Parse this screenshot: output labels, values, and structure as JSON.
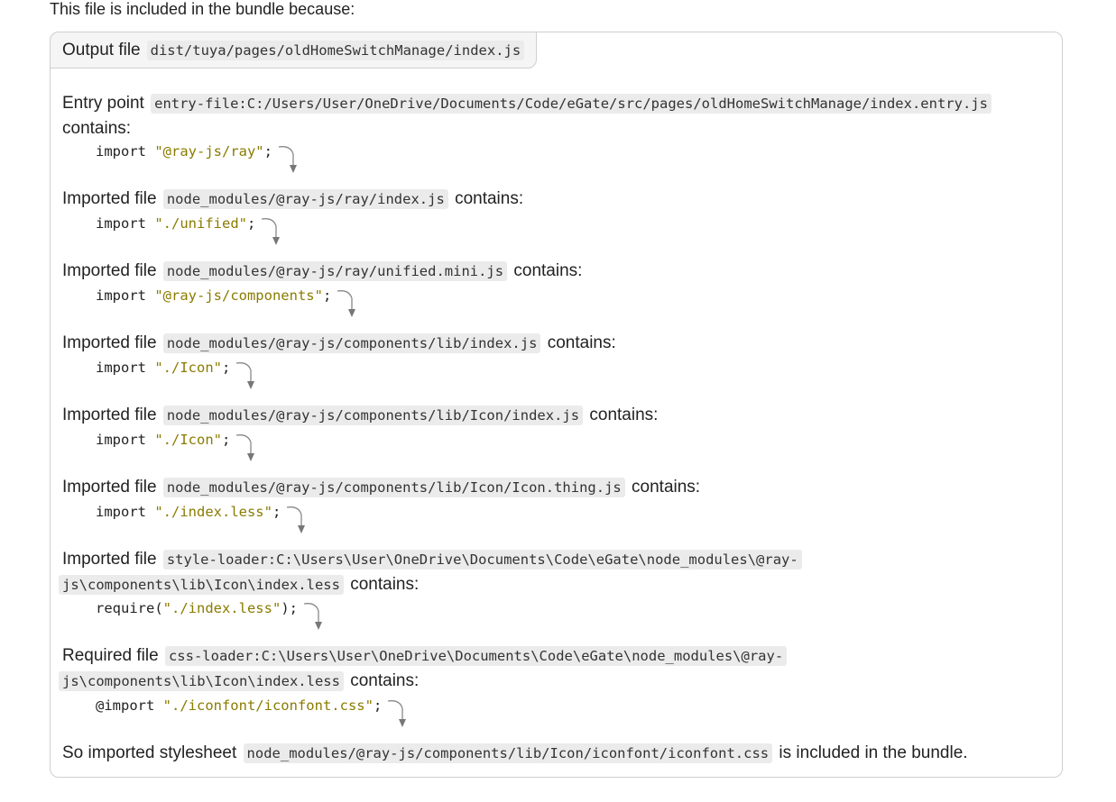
{
  "intro": "This file is included in the bundle because:",
  "output": {
    "label": "Output file",
    "path": "dist/tuya/pages/oldHomeSwitchManage/index.js"
  },
  "steps": [
    {
      "prefix": "Entry point",
      "path": "entry-file:C:/Users/User/OneDrive/Documents/Code/eGate/src/pages/oldHomeSwitchManage/index.entry.js",
      "suffix": "contains:",
      "keyword": "import ",
      "string": "\"@ray-js/ray\"",
      "tail": ";"
    },
    {
      "prefix": "Imported file",
      "path": "node_modules/@ray-js/ray/index.js",
      "suffix": "contains:",
      "keyword": "import ",
      "string": "\"./unified\"",
      "tail": ";"
    },
    {
      "prefix": "Imported file",
      "path": "node_modules/@ray-js/ray/unified.mini.js",
      "suffix": "contains:",
      "keyword": "import ",
      "string": "\"@ray-js/components\"",
      "tail": ";"
    },
    {
      "prefix": "Imported file",
      "path": "node_modules/@ray-js/components/lib/index.js",
      "suffix": "contains:",
      "keyword": "import ",
      "string": "\"./Icon\"",
      "tail": ";"
    },
    {
      "prefix": "Imported file",
      "path": "node_modules/@ray-js/components/lib/Icon/index.js",
      "suffix": "contains:",
      "keyword": "import ",
      "string": "\"./Icon\"",
      "tail": ";"
    },
    {
      "prefix": "Imported file",
      "path": "node_modules/@ray-js/components/lib/Icon/Icon.thing.js",
      "suffix": "contains:",
      "keyword": "import ",
      "string": "\"./index.less\"",
      "tail": ";"
    },
    {
      "prefix": "Imported file",
      "path_line1": "style-loader:C:\\Users\\User\\OneDrive\\Documents\\Code\\eGate\\node_modules\\@ray-",
      "path_line2": "js\\components\\lib\\Icon\\index.less",
      "suffix": "contains:",
      "keyword": "require(",
      "string": "\"./index.less\"",
      "tail": ");"
    },
    {
      "prefix": "Required file",
      "path_line1": "css-loader:C:\\Users\\User\\OneDrive\\Documents\\Code\\eGate\\node_modules\\@ray-",
      "path_line2": "js\\components\\lib\\Icon\\index.less",
      "suffix": "contains:",
      "keyword": "@import ",
      "string": "\"./iconfont/iconfont.css\"",
      "tail": ";"
    }
  ],
  "final": {
    "prefix": "So imported stylesheet",
    "path": "node_modules/@ray-js/components/lib/Icon/iconfont/iconfont.css",
    "suffix": "is included in the bundle."
  },
  "colors": {
    "string": "#8a7b00",
    "code_bg": "#ebebeb",
    "border": "#cfcfcf"
  }
}
